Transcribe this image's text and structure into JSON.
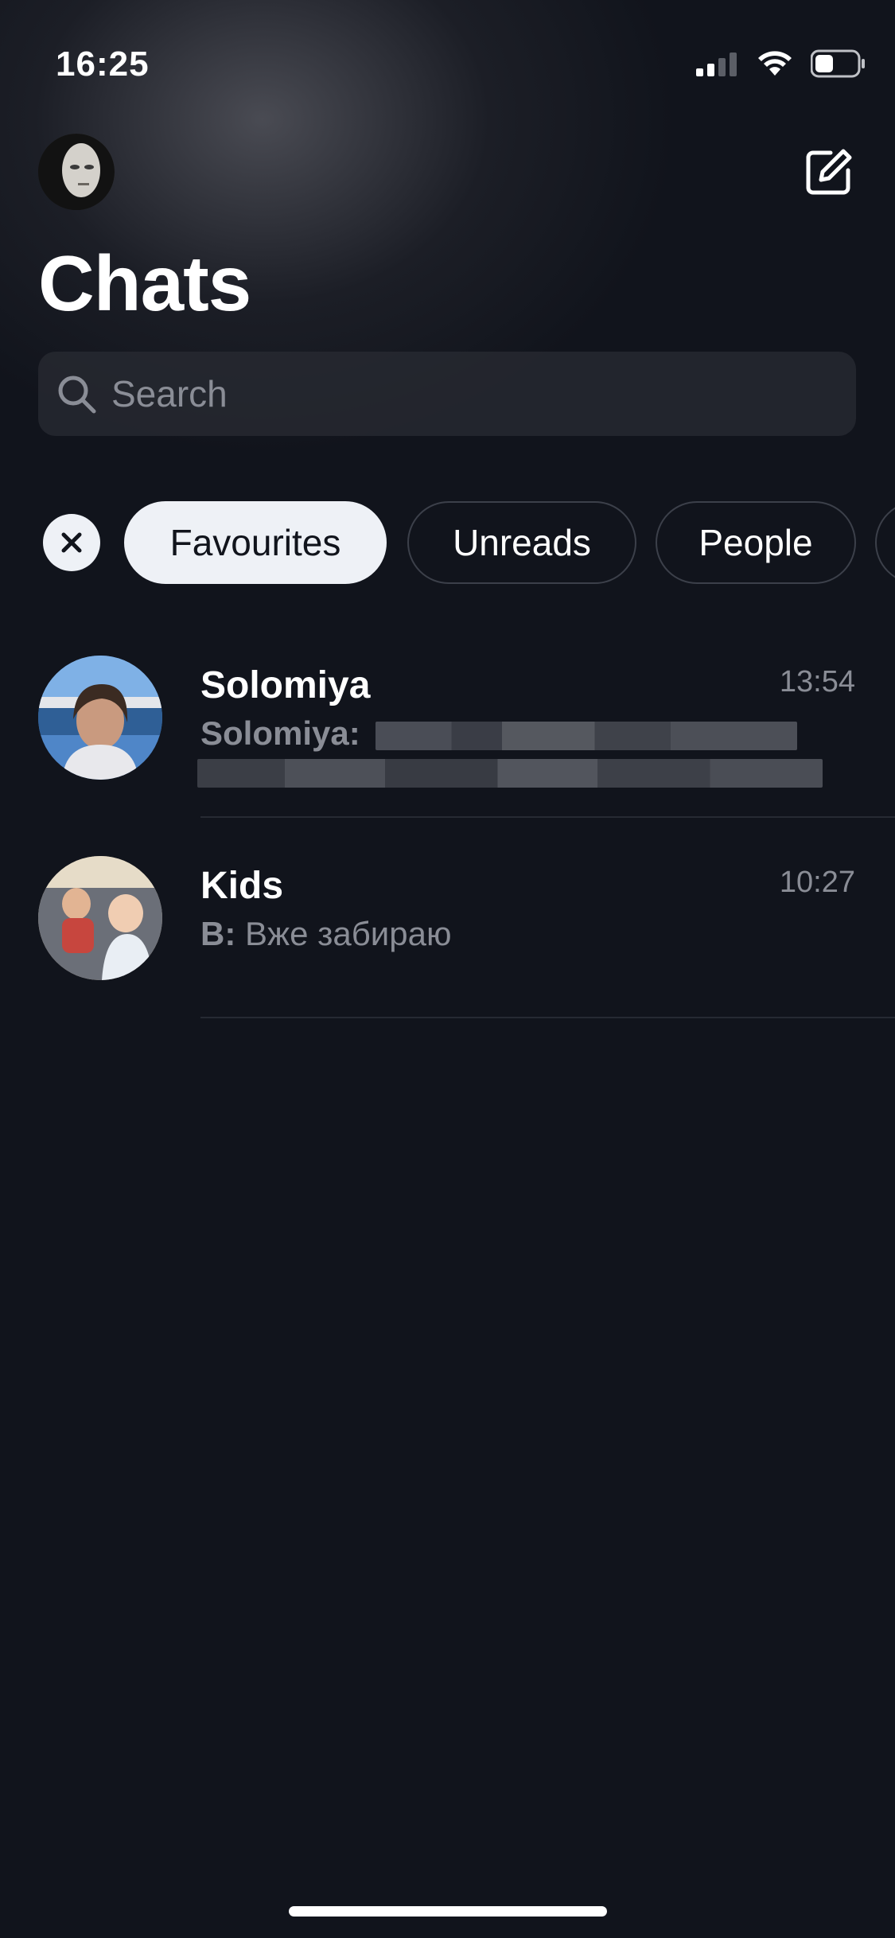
{
  "status_bar": {
    "time": "16:25"
  },
  "header": {
    "title": "Chats"
  },
  "search": {
    "placeholder": "Search"
  },
  "filters": [
    {
      "label": "Favourites",
      "active": true
    },
    {
      "label": "Unreads",
      "active": false
    },
    {
      "label": "People",
      "active": false
    }
  ],
  "chats": [
    {
      "name": "Solomiya",
      "time": "13:54",
      "sender": "Solomiya:",
      "message": ""
    },
    {
      "name": "Kids",
      "time": "10:27",
      "sender": "В:",
      "message": "Вже забираю"
    }
  ],
  "colors": {
    "background": "#11141c",
    "muted_text": "#8a8d96",
    "chip_active": "#eef1f6"
  }
}
